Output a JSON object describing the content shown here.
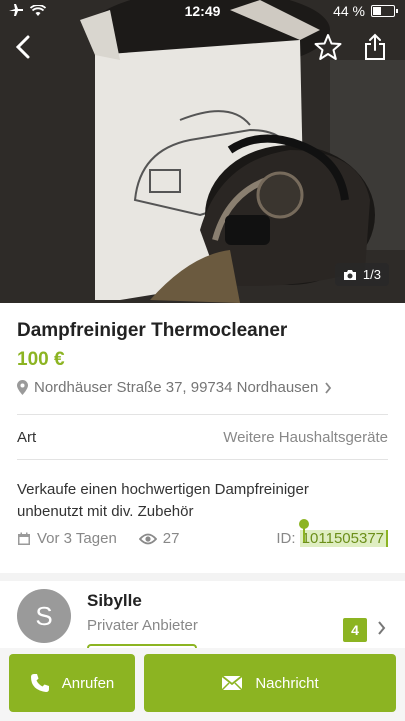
{
  "status_bar": {
    "time": "12:49",
    "battery": "44 %",
    "battery_level": 0.44
  },
  "gallery": {
    "counter": "1/3"
  },
  "listing": {
    "title": "Dampfreiniger Thermocleaner",
    "price": "100 €",
    "address": "Nordhäuser Straße 37, 99734 Nordhausen",
    "category_label": "Art",
    "category_value": "Weitere Haushaltsgeräte",
    "description": "Verkaufe einen hochwertigen Dampfreiniger unbenutzt mit div. Zubehör",
    "posted": "Vor 3 Tagen",
    "views": "27",
    "id_label": "ID:",
    "id_value": "1011505377"
  },
  "seller": {
    "initial": "S",
    "name": "Sibylle",
    "type": "Privater Anbieter",
    "count": "4"
  },
  "actions": {
    "call": "Anrufen",
    "message": "Nachricht"
  },
  "colors": {
    "accent": "#8cb422",
    "text": "#222222",
    "muted": "#888888"
  }
}
